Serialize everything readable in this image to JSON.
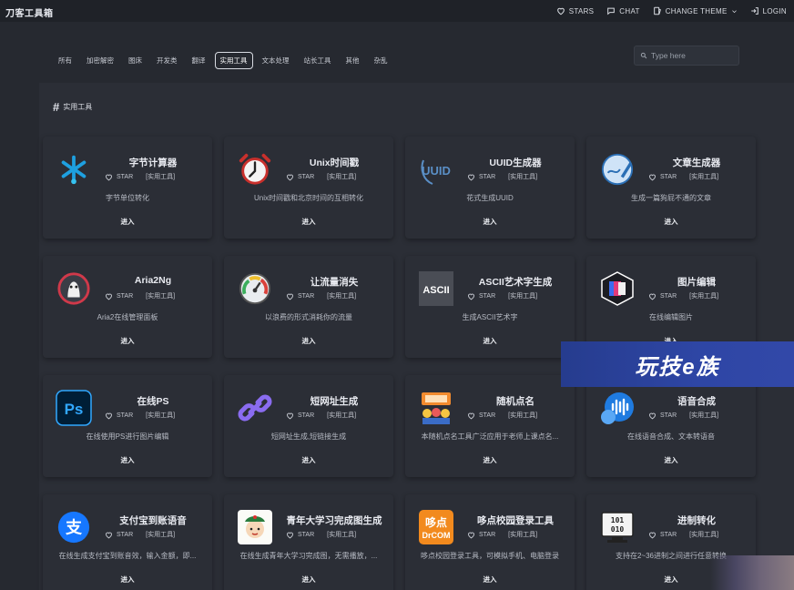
{
  "header": {
    "brand": "刀客工具箱",
    "nav": [
      {
        "label": "STARS",
        "icon": "heart-icon"
      },
      {
        "label": "CHAT",
        "icon": "chat-icon"
      },
      {
        "label": "CHANGE THEME",
        "icon": "theme-icon"
      },
      {
        "label": "LOGIN",
        "icon": "login-icon"
      }
    ]
  },
  "tabs": [
    "所有",
    "加密解密",
    "图床",
    "开发类",
    "翻译",
    "实用工具",
    "文本处理",
    "站长工具",
    "其他",
    "杂乱"
  ],
  "active_tab": "实用工具",
  "search": {
    "placeholder": "Type here"
  },
  "section": {
    "title": "实用工具"
  },
  "star_label": "STAR",
  "category_label": "[实用工具]",
  "enter_label": "进入",
  "cards": [
    {
      "title": "字节计算器",
      "desc": "字节单位转化",
      "icon": "byte-calculator-icon"
    },
    {
      "title": "Unix时间戳",
      "desc": "Unix时间戳和北京时间的互相转化",
      "icon": "alarm-clock-icon"
    },
    {
      "title": "UUID生成器",
      "desc": "花式生成UUID",
      "icon": "uuid-logo-icon"
    },
    {
      "title": "文章生成器",
      "desc": "生成一篇狗屁不通的文章",
      "icon": "writing-icon"
    },
    {
      "title": "Aria2Ng",
      "desc": "Aria2在线管理面板",
      "icon": "aria2-logo-icon"
    },
    {
      "title": "让流量消失",
      "desc": "以浪费的形式消耗你的流量",
      "icon": "speedometer-icon"
    },
    {
      "title": "ASCII艺术字生成",
      "desc": "生成ASCII艺术字",
      "icon": "ascii-logo-icon"
    },
    {
      "title": "图片编辑",
      "desc": "在线编辑图片",
      "icon": "image-editor-icon"
    },
    {
      "title": "在线PS",
      "desc": "在线使用PS进行图片编辑",
      "icon": "photoshop-icon"
    },
    {
      "title": "短网址生成",
      "desc": "短网址生成,短链接生成",
      "icon": "link-icon"
    },
    {
      "title": "随机点名",
      "desc": "本随机点名工具广泛应用于老师上课点名...",
      "icon": "random-name-icon"
    },
    {
      "title": "语音合成",
      "desc": "在线语音合成、文本转语音",
      "icon": "voice-icon"
    },
    {
      "title": "支付宝到账语音",
      "desc": "在线生成支付宝到账音效，输入金额，即...",
      "icon": "alipay-icon"
    },
    {
      "title": "青年大学习完成图生成",
      "desc": "在线生成青年大学习完成图，无需播放，...",
      "icon": "youth-study-icon"
    },
    {
      "title": "哆点校园登录工具",
      "desc": "哆点校园登录工具，可模拟手机、电脑登录",
      "icon": "drcom-icon"
    },
    {
      "title": "进制转化",
      "desc": "支持在2~36进制之间进行任意转换",
      "icon": "binary-icon"
    }
  ],
  "watermark": {
    "text": "玩技e族"
  },
  "colors": {
    "background": "#262930",
    "card": "#2b2e36",
    "topbar": "#1f2228",
    "watermark": "#2e46a5"
  }
}
